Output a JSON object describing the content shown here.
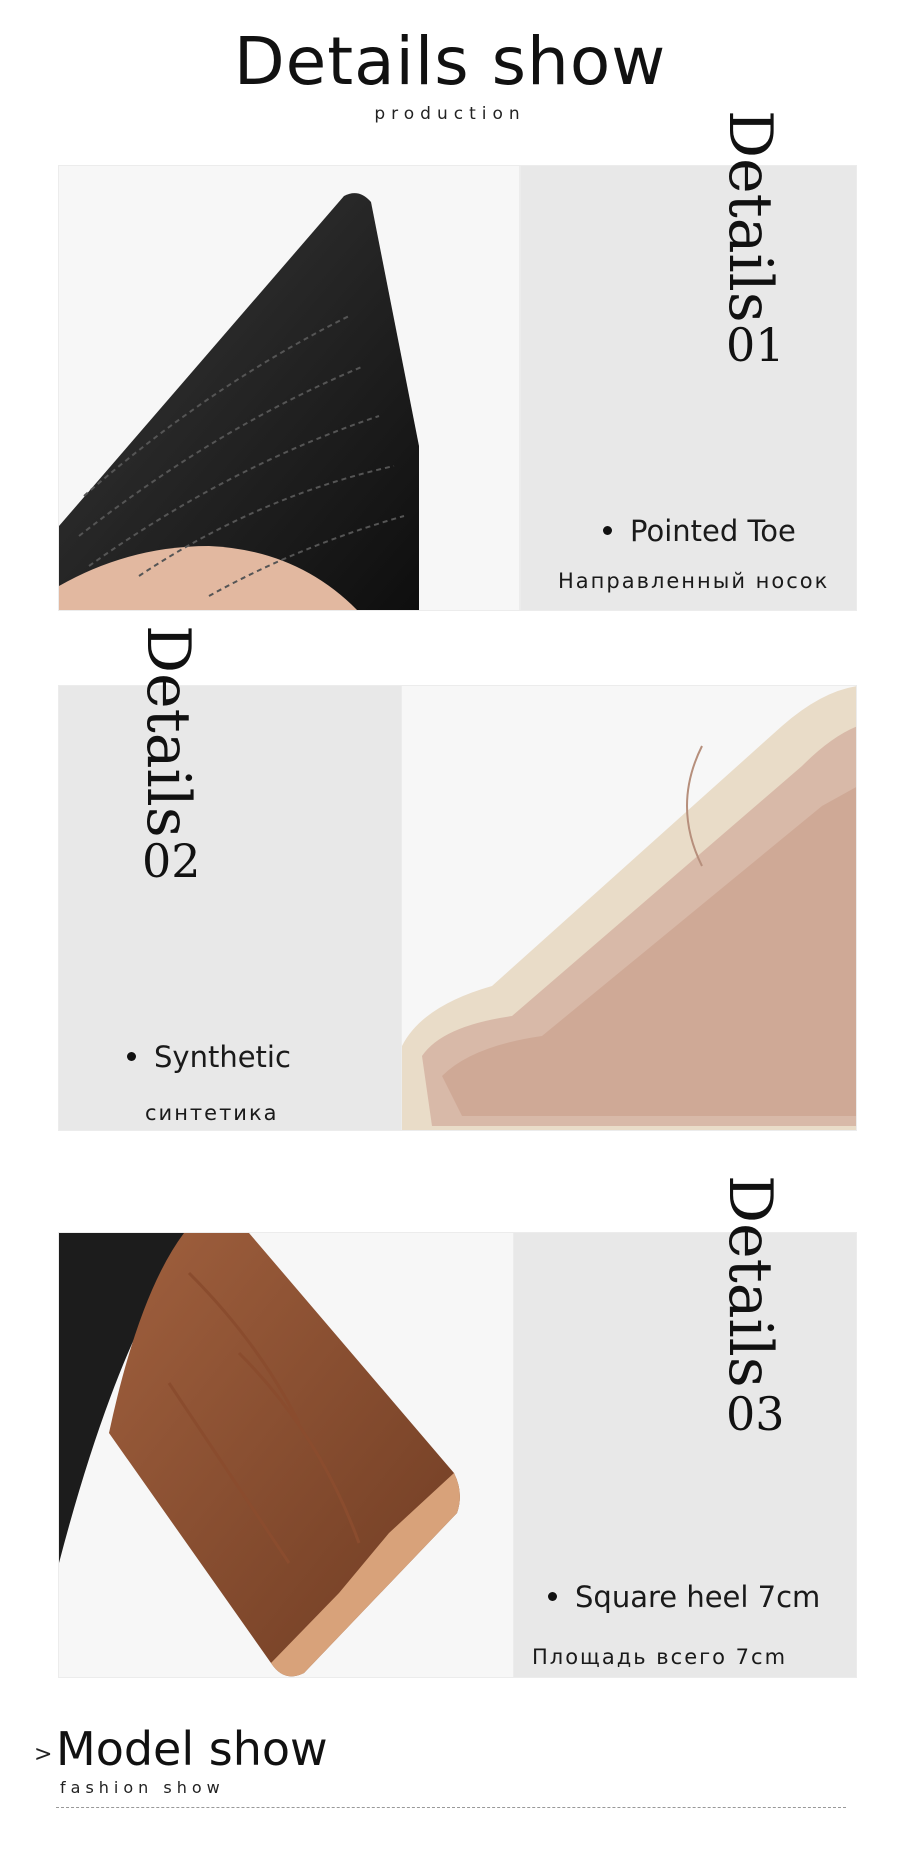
{
  "header": {
    "title": "Details show",
    "subtitle": "production"
  },
  "details": [
    {
      "label": "Details",
      "number": "01",
      "feature": "Pointed Toe",
      "feature_ru": "Направленный носок"
    },
    {
      "label": "Details",
      "number": "02",
      "feature": "Synthetic",
      "feature_ru": "синтетика"
    },
    {
      "label": "Details",
      "number": "03",
      "feature": "Square heel 7cm",
      "feature_ru": "Площадь всего 7cm"
    }
  ],
  "footer": {
    "arrow": ">",
    "title": "Model show",
    "subtitle": "fashion show"
  }
}
